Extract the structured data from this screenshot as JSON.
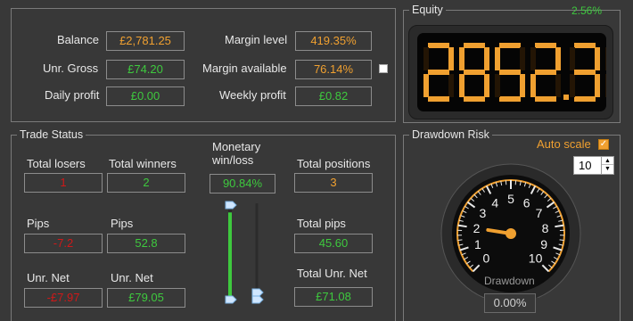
{
  "account": {
    "balance_label": "Balance",
    "balance_value": "£2,781.25",
    "unr_gross_label": "Unr. Gross",
    "unr_gross_value": "£74.20",
    "daily_profit_label": "Daily profit",
    "daily_profit_value": "£0.00",
    "margin_level_label": "Margin level",
    "margin_level_value": "419.35%",
    "margin_available_label": "Margin available",
    "margin_available_value": "76.14%",
    "weekly_profit_label": "Weekly profit",
    "weekly_profit_value": "£0.82"
  },
  "equity": {
    "title": "Equity",
    "change_percent": "2.56%",
    "display_value": "2852.33"
  },
  "trade_status": {
    "title": "Trade Status",
    "total_losers_label": "Total losers",
    "total_losers_value": "1",
    "total_winners_label": "Total winners",
    "total_winners_value": "2",
    "monetary_label_line1": "Monetary",
    "monetary_label_line2": "win/loss",
    "monetary_value": "90.84%",
    "monetary_win_fraction": 0.9084,
    "total_positions_label": "Total positions",
    "total_positions_value": "3",
    "losers_pips_label": "Pips",
    "losers_pips_value": "-7.2",
    "winners_pips_label": "Pips",
    "winners_pips_value": "52.8",
    "total_pips_label": "Total pips",
    "total_pips_value": "45.60",
    "losers_unr_net_label": "Unr. Net",
    "losers_unr_net_value": "-£7.97",
    "winners_unr_net_label": "Unr. Net",
    "winners_unr_net_value": "£79.05",
    "total_unr_net_label": "Total Unr. Net",
    "total_unr_net_value": "£71.08"
  },
  "drawdown": {
    "title": "Drawdown Risk",
    "auto_scale_label": "Auto scale",
    "auto_scale_checked": true,
    "scale_value": "10",
    "gauge_min": 0,
    "gauge_max": 10,
    "gauge_ticks": [
      "0",
      "1",
      "2",
      "3",
      "4",
      "5",
      "6",
      "7",
      "8",
      "9",
      "10"
    ],
    "gauge_caption": "Drawdown",
    "gauge_needle_value": 2,
    "drawdown_value": "0.00%"
  },
  "colors": {
    "accent_orange": "#f0a030",
    "positive_green": "#3ec93e",
    "negative_red": "#d01818",
    "loss_bar_blue": "#3a4a90"
  }
}
